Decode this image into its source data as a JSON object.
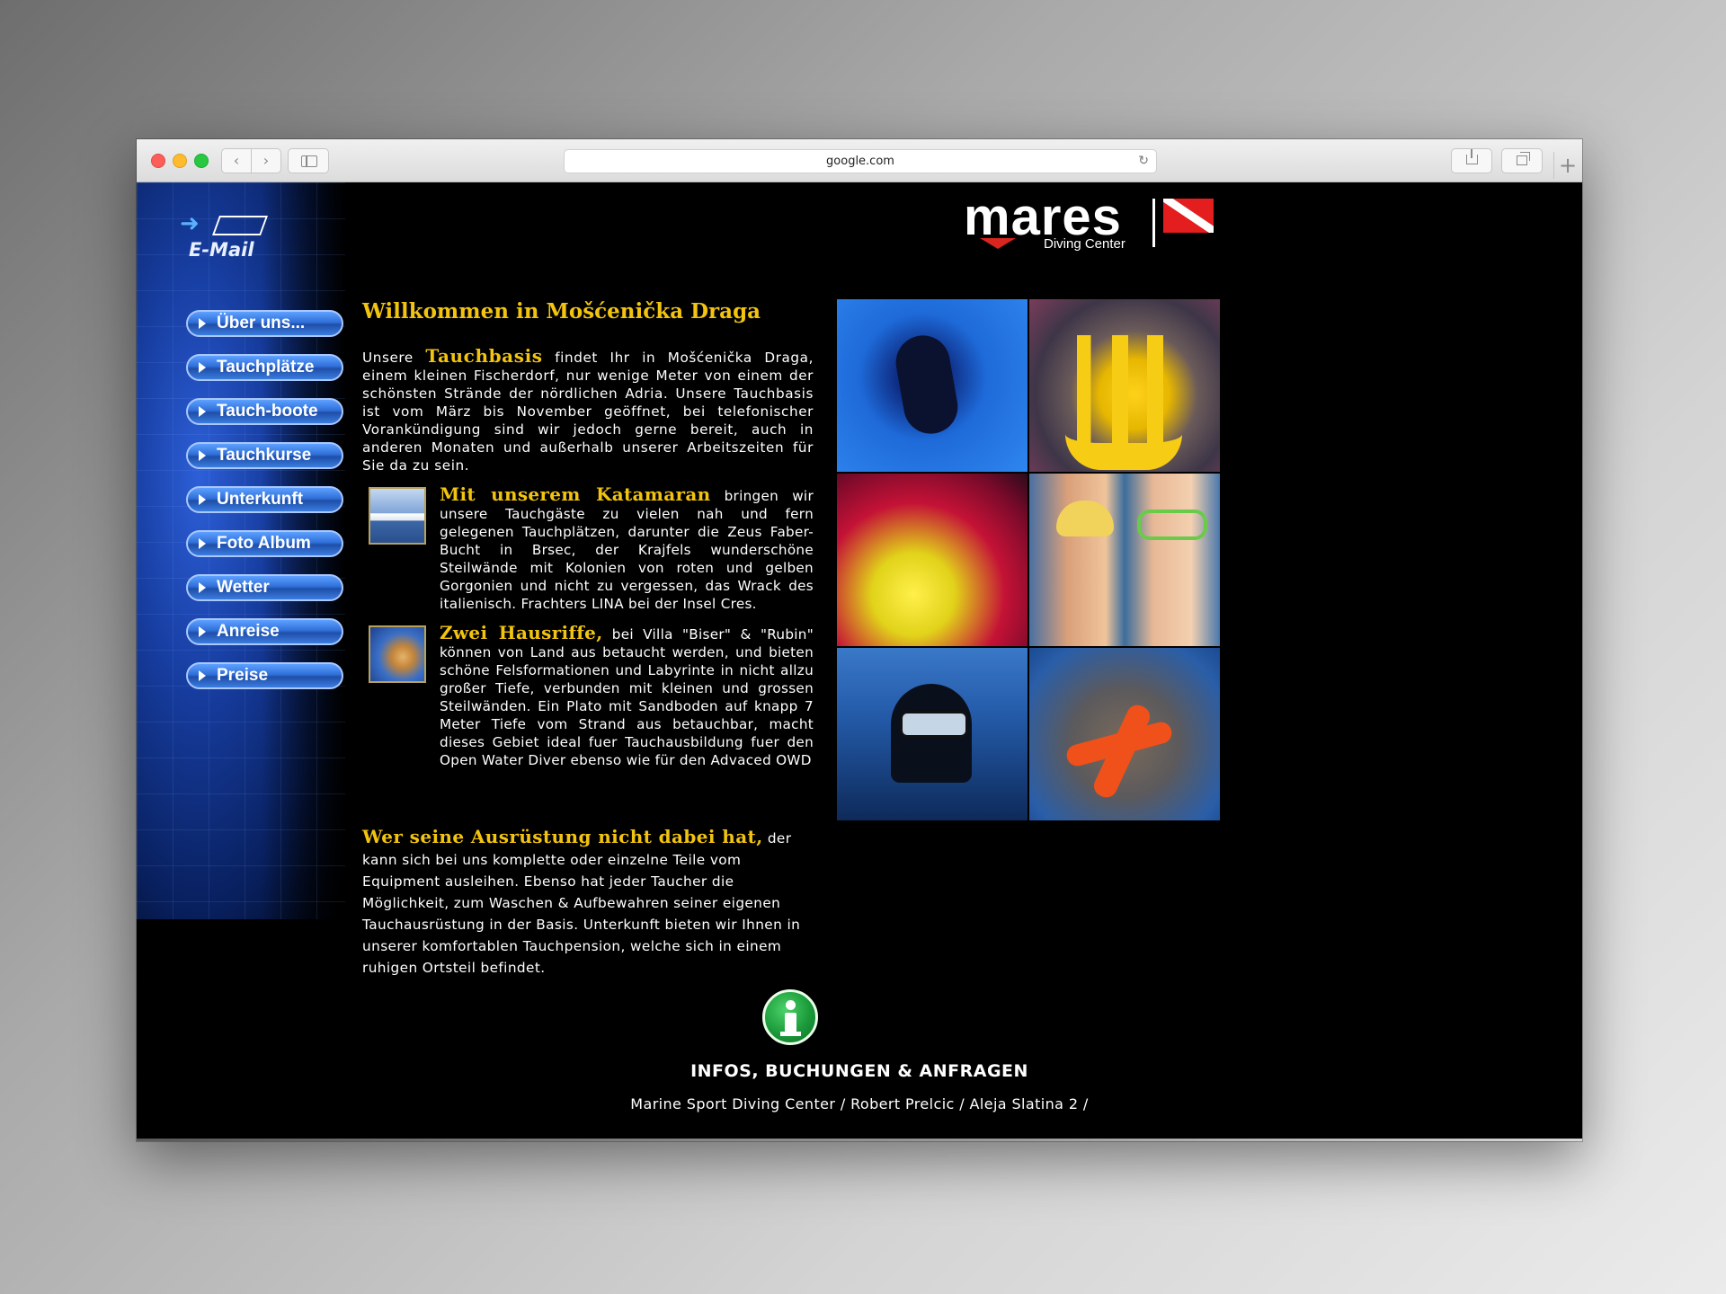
{
  "browser": {
    "url": "google.com",
    "reload_glyph": "↻",
    "back_glyph": "‹",
    "forward_glyph": "›",
    "newtab_glyph": "+"
  },
  "sidebar": {
    "email_label": "E-Mail",
    "items": [
      {
        "label": "Über uns..."
      },
      {
        "label": "Tauchplätze"
      },
      {
        "label": "Tauch-boote"
      },
      {
        "label": "Tauchkurse"
      },
      {
        "label": "Unterkunft"
      },
      {
        "label": "Foto Album"
      },
      {
        "label": "Wetter"
      },
      {
        "label": "Anreise"
      },
      {
        "label": "Preise"
      }
    ]
  },
  "logo": {
    "word": "mares",
    "sub": "Diving Center"
  },
  "main": {
    "title": "Willkommen in Mošćenička Draga",
    "intro_prefix": "Unsere ",
    "intro_highlight": "Tauchbasis",
    "intro_text": " findet Ihr in Mošćenička Draga, einem kleinen Fischerdorf, nur wenige Meter von einem der schönsten Strände der nördlichen Adria. Unsere Tauchbasis ist vom März bis November geöffnet, bei telefonischer Vorankündigung sind wir jedoch gerne bereit, auch in anderen Monaten und außerhalb unserer Arbeitszeiten für Sie da zu sein.",
    "katamaran_highlight": "Mit unserem Katamaran",
    "katamaran_text": " bringen wir unsere Tauchgäste zu vielen nah und fern gelegenen Tauchplätzen, darunter die Zeus Faber-Bucht in Brsec, der Krajfels wunderschöne Steilwände mit Kolonien von roten und gelben Gorgonien und nicht zu vergessen, das Wrack des italienisch. Frachters LINA bei der Insel Cres.",
    "hausriffe_highlight": "Zwei Hausriffe,",
    "hausriffe_text": " bei Villa \"Biser\" & \"Rubin\" können von Land aus betaucht werden, und bieten schöne Felsformationen und Labyrinte in nicht allzu großer Tiefe, verbunden mit kleinen und grossen Steilwänden. Ein Plato mit Sandboden auf knapp 7 Meter Tiefe vom Strand aus betauchbar, macht dieses Gebiet ideal fuer Tauchausbildung fuer den Open Water Diver ebenso wie für den Advaced OWD",
    "equipment_highlight": "Wer seine Ausrüstung nicht dabei hat,",
    "equipment_text": " der kann sich bei uns komplette oder einzelne Teile vom Equipment ausleihen. Ebenso hat jeder Taucher die Möglichkeit, zum Waschen & Aufbewahren seiner eigenen Tauchausrüstung in der Basis. Unterkunft bieten wir Ihnen in unserer komfortablen Tauchpension, welche sich in einem ruhigen Ortsteil befindet."
  },
  "footer": {
    "info_title": "INFOS, BUCHUNGEN & ANFRAGEN",
    "address": "Marine Sport Diving Center / Robert Prelcic / Aleja Slatina 2 /"
  },
  "colors": {
    "highlight": "#f2c40f",
    "page_bg": "#000000",
    "nav_blue": "#2f6fd8",
    "info_green": "#1b9a3a",
    "logo_red": "#e41e1e"
  }
}
